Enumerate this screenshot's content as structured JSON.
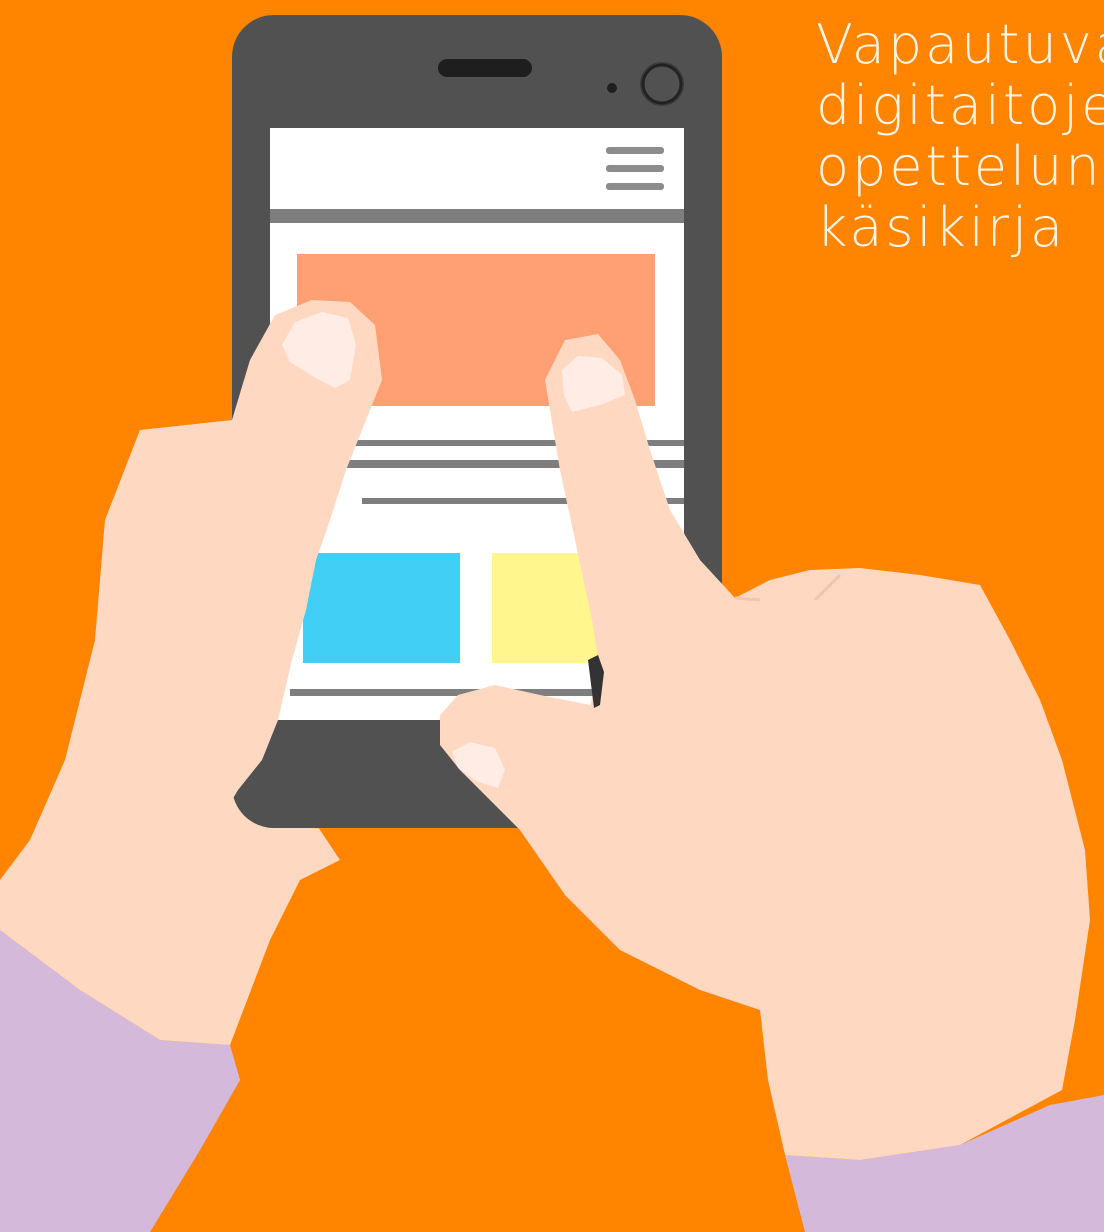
{
  "cover": {
    "title_lines": [
      "Vapautuva",
      "digitaitojen",
      "opettelun",
      "käsikirja"
    ]
  },
  "colors": {
    "background": "#FF8500",
    "title_text": "#FFF4E6",
    "phone_body": "#515151",
    "screen": "#FFFFFF",
    "banner_block": "#FF9F74",
    "blue_block": "#42CFF5",
    "yellow_block": "#FFF68E",
    "skin": "#FFD8C2",
    "nail": "#FFEDE5",
    "sleeve": "#D5B9DB"
  },
  "icons": [
    "hamburger-menu-icon",
    "camera-icon",
    "speaker-icon",
    "smartphone-icon",
    "hand-icon"
  ]
}
